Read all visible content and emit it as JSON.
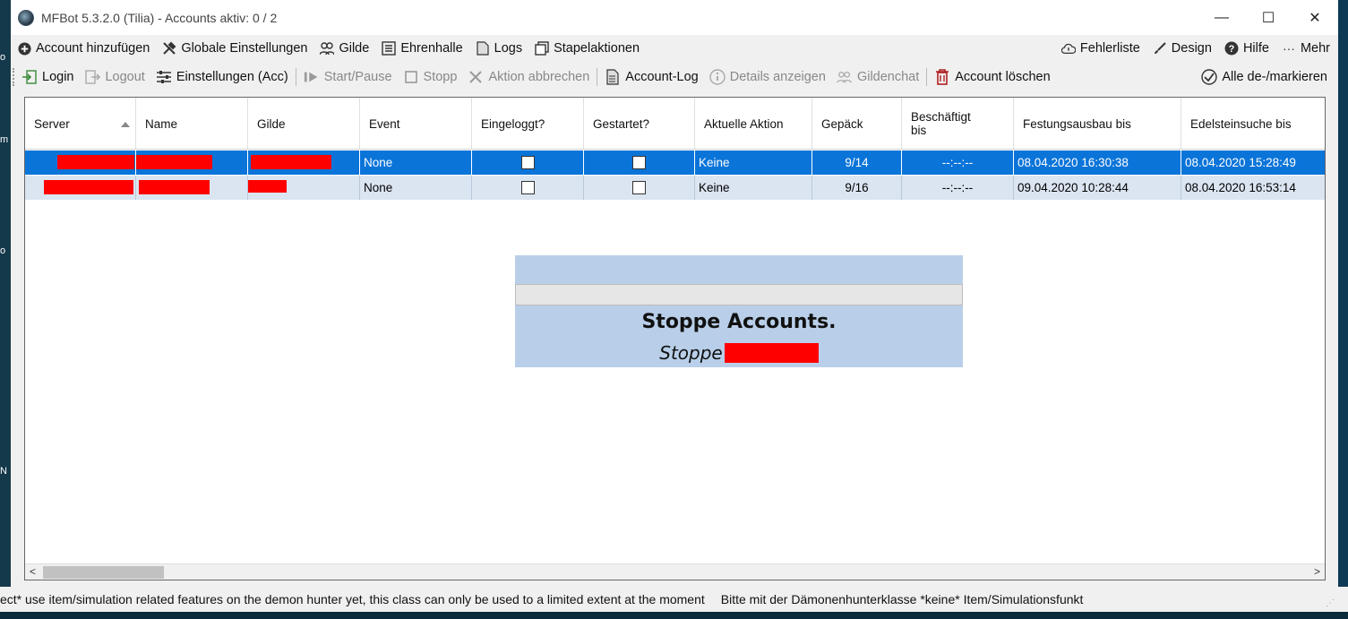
{
  "window": {
    "title": "MFBot 5.3.2.0 (Tilia) - Accounts aktiv: 0 / 2",
    "minimize": "—",
    "maximize": "☐",
    "close": "✕"
  },
  "menu": {
    "left": [
      {
        "label": "Account hinzufügen",
        "icon": "plus-circle-icon"
      },
      {
        "label": "Globale Einstellungen",
        "icon": "tools-icon"
      },
      {
        "label": "Gilde",
        "icon": "users-icon"
      },
      {
        "label": "Ehrenhalle",
        "icon": "list-icon"
      },
      {
        "label": "Logs",
        "icon": "document-icon"
      },
      {
        "label": "Stapelaktionen",
        "icon": "stack-icon"
      }
    ],
    "right": [
      {
        "label": "Fehlerliste",
        "icon": "cloud-icon"
      },
      {
        "label": "Design",
        "icon": "brush-icon"
      },
      {
        "label": "Hilfe",
        "icon": "help-icon"
      },
      {
        "label": "Mehr",
        "icon": "ellipsis-icon"
      }
    ]
  },
  "toolbar": {
    "login": "Login",
    "logout": "Logout",
    "settings_acc": "Einstellungen (Acc)",
    "start_pause": "Start/Pause",
    "stop": "Stopp",
    "abort": "Aktion abbrechen",
    "account_log": "Account-Log",
    "details": "Details anzeigen",
    "guild_chat": "Gildenchat",
    "delete_account": "Account löschen",
    "toggle_all": "Alle de-/markieren"
  },
  "grid": {
    "columns": [
      "Server",
      "Name",
      "Gilde",
      "Event",
      "Eingeloggt?",
      "Gestartet?",
      "Aktuelle Aktion",
      "Gepäck",
      "Beschäftigt bis",
      "Festungsausbau bis",
      "Edelsteinsuche bis"
    ],
    "sorted_column": "Server",
    "rows": [
      {
        "event": "None",
        "logged_in": false,
        "started": false,
        "action": "Keine",
        "bag": "9/14",
        "busy_until": "--:--:--",
        "fortress_until": "08.04.2020 16:30:38",
        "gem_until": "08.04.2020 15:28:49",
        "selected": true
      },
      {
        "event": "None",
        "logged_in": false,
        "started": false,
        "action": "Keine",
        "bag": "9/16",
        "busy_until": "--:--:--",
        "fortress_until": "09.04.2020 10:28:44",
        "gem_until": "08.04.2020 16:53:14",
        "selected": false
      }
    ]
  },
  "overlay": {
    "title": "Stoppe Accounts.",
    "subtitle_prefix": "Stoppe"
  },
  "statusbar": {
    "message_en": "ect* use item/simulation related features on the demon hunter yet, this class can only be used to a limited extent at the moment",
    "message_de": "Bitte mit der Dämonenhunterklasse *keine* Item/Simulationsfunkt"
  },
  "colors": {
    "selection": "#0a74d9",
    "alt_row": "#dbe5f1",
    "overlay": "#b9cfe9",
    "redaction": "#ff0000"
  }
}
